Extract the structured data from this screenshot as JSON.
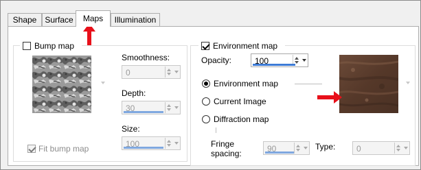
{
  "tabs": [
    {
      "label": "Shape"
    },
    {
      "label": "Surface"
    },
    {
      "label": "Maps"
    },
    {
      "label": "Illumination"
    }
  ],
  "bump": {
    "checkbox_label": "Bump map",
    "checked": false,
    "smoothness_label": "Smoothness:",
    "smoothness_value": "0",
    "depth_label": "Depth:",
    "depth_value": "30",
    "size_label": "Size:",
    "size_value": "100",
    "fit_label": "Fit bump map",
    "fit_checked": true
  },
  "environment": {
    "checkbox_label": "Environment map",
    "checked": true,
    "opacity_label": "Opacity:",
    "opacity_value": "100",
    "options": [
      {
        "label": "Environment map",
        "selected": true
      },
      {
        "label": "Current Image",
        "selected": false
      },
      {
        "label": "Diffraction map",
        "selected": false
      }
    ],
    "fringe_label_line1": "Fringe",
    "fringe_label_line2": "spacing:",
    "fringe_value": "90",
    "type_label": "Type:",
    "type_value": "0"
  },
  "colors": {
    "accent": "#3d7bd6",
    "annotation_arrow": "#e8101a",
    "env_texture": "#5a3e30"
  },
  "icons": {
    "tab_pointer": "red-arrow-up-icon",
    "map_pointer": "red-arrow-right-icon"
  }
}
